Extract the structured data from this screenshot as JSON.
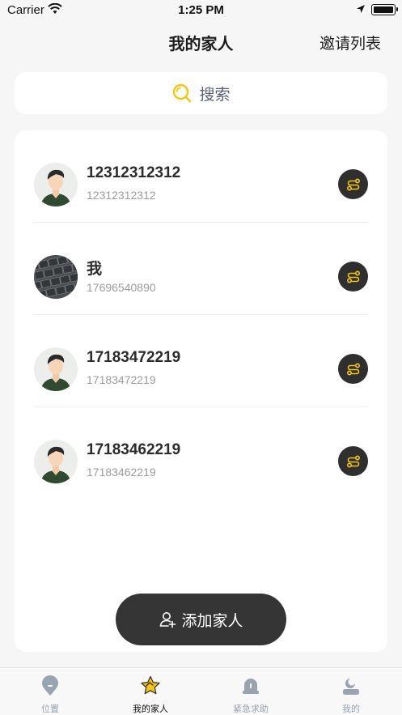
{
  "status_bar": {
    "carrier": "Carrier",
    "time": "1:25 PM"
  },
  "nav": {
    "title": "我的家人",
    "right_action": "邀请列表"
  },
  "search": {
    "placeholder": "搜索"
  },
  "members": [
    {
      "name": "12312312312",
      "phone": "12312312312",
      "avatar": "default-avatar"
    },
    {
      "name": "我",
      "phone": "17696540890",
      "avatar": "keyboard-photo"
    },
    {
      "name": "17183472219",
      "phone": "17183472219",
      "avatar": "default-avatar"
    },
    {
      "name": "17183462219",
      "phone": "17183462219",
      "avatar": "default-avatar"
    }
  ],
  "add_button": {
    "label": "添加家人"
  },
  "tabs": [
    {
      "label": "位置",
      "icon": "location-icon"
    },
    {
      "label": "我的家人",
      "icon": "star-icon",
      "active": true
    },
    {
      "label": "紧急求助",
      "icon": "alarm-icon"
    },
    {
      "label": "我的",
      "icon": "profile-icon"
    }
  ],
  "colors": {
    "accent": "#f5c518",
    "dark": "#353535",
    "inactive": "#9aa3b1"
  }
}
